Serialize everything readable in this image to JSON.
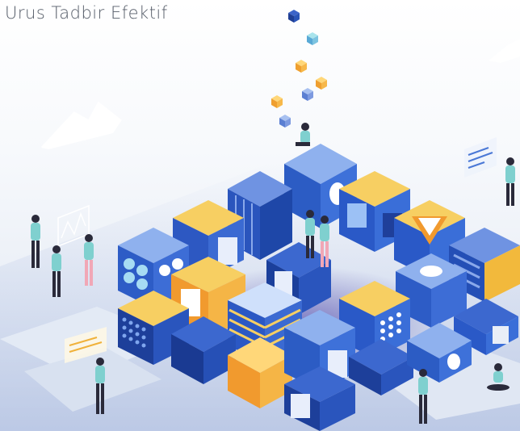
{
  "header": {
    "title": "Urus Tadbir Efektif"
  },
  "palette": {
    "navy": "#1c3f95",
    "blue": "#2f63c8",
    "light_blue": "#8fb4ee",
    "yellow": "#f5c24c",
    "orange": "#f19a2e",
    "teal_shirt": "#7fd0cf",
    "pink_shirt": "#f1a7b6",
    "ground": "#dfe6f1"
  },
  "illustration": {
    "icons": [
      "isometric-cube-cluster",
      "floating-small-cubes",
      "mountain-outline",
      "presentation-board",
      "teamwork-people"
    ]
  }
}
